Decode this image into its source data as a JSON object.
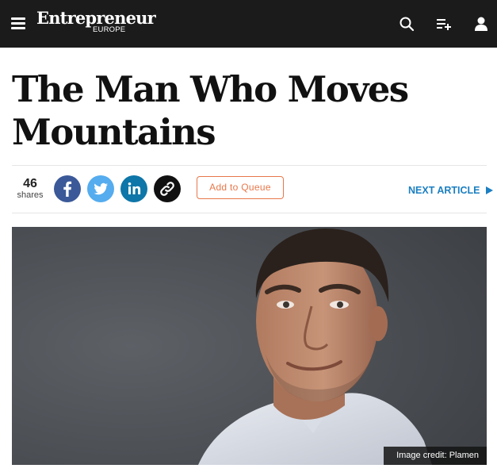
{
  "header": {
    "brand": "Entrepreneur",
    "region": "EUROPE",
    "icons": [
      "menu-icon",
      "search-icon",
      "add-to-queue-icon",
      "user-icon"
    ]
  },
  "article": {
    "title": "The Man Who Moves Mountains",
    "shares": {
      "count": "46",
      "label": "shares"
    },
    "social": [
      "facebook-icon",
      "twitter-icon",
      "linkedin-icon",
      "link-icon"
    ],
    "queue_button": "Add to Queue",
    "next_label": "NEXT ARTICLE",
    "image_credit": "Image credit: Plamen"
  },
  "colors": {
    "topbar": "#1b1b1b",
    "accent_orange": "#e8774a",
    "link_blue": "#1b7fc2",
    "facebook": "#3b5998",
    "twitter": "#55acee",
    "linkedin": "#0e76a8"
  }
}
